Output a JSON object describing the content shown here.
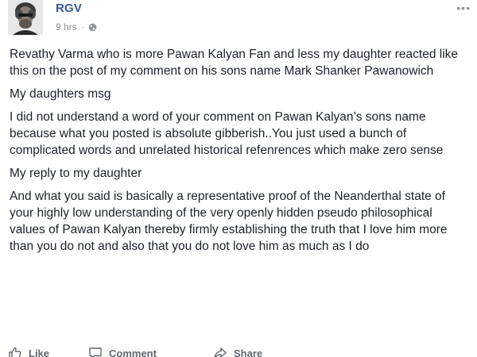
{
  "post": {
    "author": "RGV",
    "time": "9 hrs",
    "separator": "·",
    "more": "•••",
    "paragraphs": [
      "Revathy Varma who is more Pawan Kalyan Fan and less my daughter reacted like this on the post of my comment on his sons name Mark Shanker Pawanowich",
      "My daughters msg",
      "I did not understand a word of your comment on Pawan Kalyan’s sons name because what you posted is absolute gibberish..You just used a bunch of complicated words and unrelated historical refenrences which make zero sense",
      "My reply to my daughter",
      "And what you said is basically a representative proof of the Neanderthal state of your highly low understanding of the very openly hidden pseudo philosophical values of Pawan Kalyan thereby firmly establishing the truth that I love him more than you do not and also that you do not love him as much as I do"
    ]
  },
  "actions": {
    "like": "Like",
    "comment": "Comment",
    "share": "Share"
  },
  "icons": {
    "avatar": "profile-photo",
    "privacy": "globe-icon",
    "like": "thumbs-up-icon",
    "comment": "comment-icon",
    "share": "share-icon"
  },
  "colors": {
    "author": "#365899",
    "meta": "#90949c",
    "text": "#1d2129",
    "action": "#606770"
  }
}
